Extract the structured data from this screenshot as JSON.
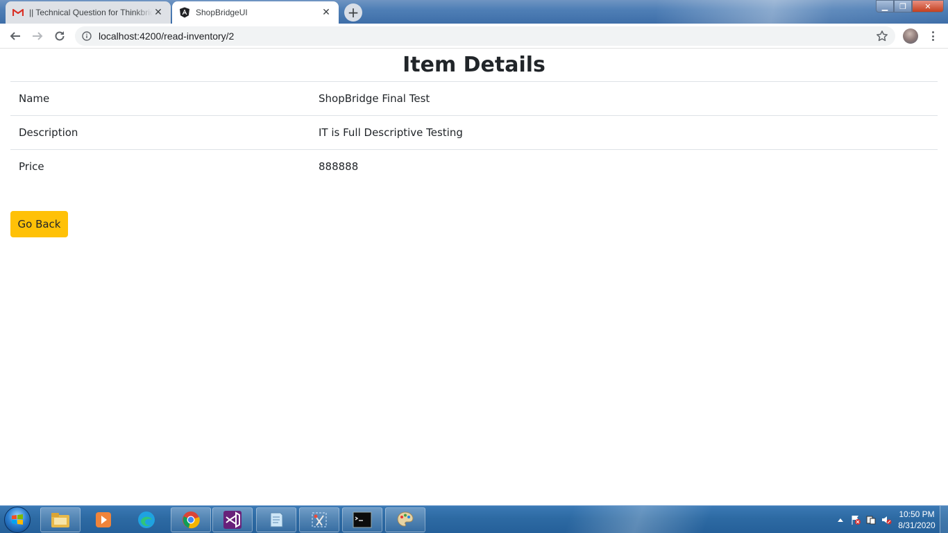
{
  "browser": {
    "tabs": [
      {
        "title": "|| Technical Question for Thinkbridge",
        "icon": "gmail-icon",
        "active": false
      },
      {
        "title": "ShopBridgeUI",
        "icon": "angular-icon",
        "active": true
      }
    ],
    "url": "localhost:4200/read-inventory/2"
  },
  "page": {
    "heading": "Item Details",
    "rows": [
      {
        "label": "Name",
        "value": "ShopBridge Final Test"
      },
      {
        "label": "Description",
        "value": "IT is Full Descriptive Testing"
      },
      {
        "label": "Price",
        "value": "888888"
      }
    ],
    "go_back_label": "Go Back"
  },
  "taskbar": {
    "pinned": [
      "explorer-icon",
      "media-player-icon",
      "edge-icon",
      "chrome-icon",
      "visual-studio-icon",
      "notepad-icon",
      "snipping-icon",
      "cmd-icon",
      "paint-icon"
    ],
    "clock": {
      "time": "10:50 PM",
      "date": "8/31/2020"
    }
  },
  "colors": {
    "accent_button": "#ffc107",
    "text": "#212529",
    "row_border": "#dee2e6"
  }
}
